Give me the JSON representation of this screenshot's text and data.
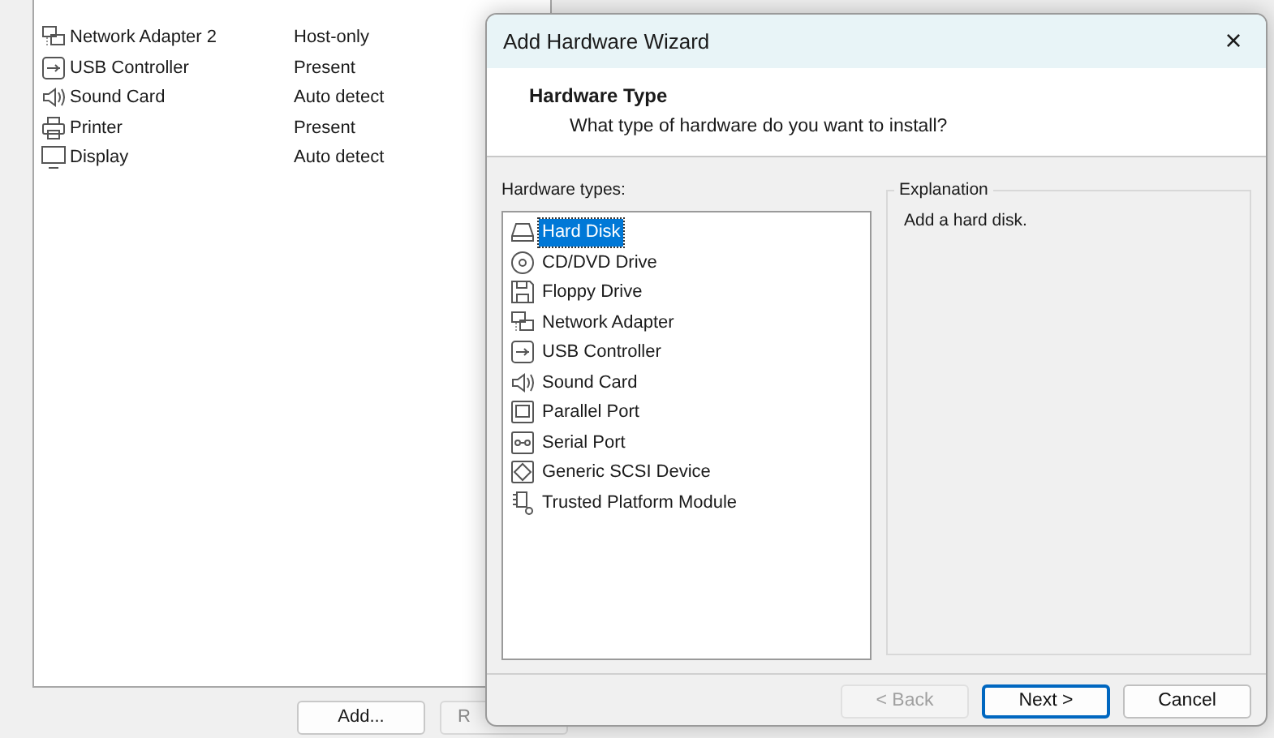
{
  "background_window": {
    "devices": [
      {
        "kind": "network",
        "name": "Network Adapter 2",
        "summary": "Host-only"
      },
      {
        "kind": "usb",
        "name": "USB Controller",
        "summary": "Present"
      },
      {
        "kind": "sound",
        "name": "Sound Card",
        "summary": "Auto detect"
      },
      {
        "kind": "printer",
        "name": "Printer",
        "summary": "Present"
      },
      {
        "kind": "display",
        "name": "Display",
        "summary": "Auto detect"
      }
    ],
    "buttons": [
      "Add...",
      "R"
    ]
  },
  "dialog": {
    "title": "Add Hardware Wizard",
    "close": "×",
    "heading": "Hardware Type",
    "subheading": "What type of hardware do you want to install?",
    "list_label": "Hardware types:",
    "hardware_types": [
      {
        "kind": "disk",
        "label": "Hard Disk",
        "selected": true
      },
      {
        "kind": "cd",
        "label": "CD/DVD Drive",
        "selected": false
      },
      {
        "kind": "floppy",
        "label": "Floppy Drive",
        "selected": false
      },
      {
        "kind": "network",
        "label": "Network Adapter",
        "selected": false
      },
      {
        "kind": "usb",
        "label": "USB Controller",
        "selected": false
      },
      {
        "kind": "sound",
        "label": "Sound Card",
        "selected": false
      },
      {
        "kind": "parallel",
        "label": "Parallel Port",
        "selected": false
      },
      {
        "kind": "serial",
        "label": "Serial Port",
        "selected": false
      },
      {
        "kind": "scsi",
        "label": "Generic SCSI Device",
        "selected": false
      },
      {
        "kind": "tpm",
        "label": "Trusted Platform Module",
        "selected": false
      }
    ],
    "explanation_title": "Explanation",
    "explanation": "Add a hard disk.",
    "buttons": [
      {
        "label": "< Back",
        "disabled": true,
        "default": false
      },
      {
        "label": "Next >",
        "disabled": false,
        "default": true
      },
      {
        "label": "Cancel",
        "disabled": false,
        "default": false
      }
    ]
  }
}
